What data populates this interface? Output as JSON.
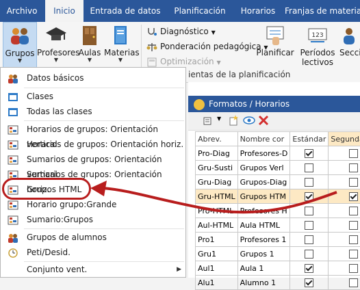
{
  "menubar": {
    "tabs": [
      "Archivo",
      "Inicio",
      "Entrada de datos",
      "Planificación",
      "Horarios",
      "Franjas de materias"
    ]
  },
  "ribbon": {
    "buttons": {
      "grupos": "Grupos",
      "profesores": "Profesores",
      "aulas": "Aulas",
      "materias": "Materias",
      "planificar": "Planificar",
      "periodos": "Períodos lectivos",
      "secciones": "Secci"
    },
    "commands": {
      "diagnostico": "Diagnóstico",
      "ponderacion": "Ponderación pedagógica",
      "optimizacion": "Optimización"
    },
    "group_label": "ientas de la planificación"
  },
  "dropdown": {
    "items": [
      {
        "label": "Datos básicos",
        "icon": "people-icon"
      },
      {
        "label": "Clases",
        "icon": "window-icon"
      },
      {
        "label": "Todas las clases",
        "icon": "window-icon"
      },
      {
        "label": "Horarios de grupos: Orientación vertical",
        "icon": "grid-icon"
      },
      {
        "label": "Horarios de grupos: Orientación horiz.",
        "icon": "grid-icon"
      },
      {
        "label": "Sumarios de grupos: Orientación vertical",
        "icon": "grid-icon"
      },
      {
        "label": "Sumarios de grupos: Orientación horiz.",
        "icon": "grid-icon"
      },
      {
        "label": "Grupos HTML",
        "icon": "grid-icon"
      },
      {
        "label": "Horario grupo:Grande",
        "icon": "grid-icon"
      },
      {
        "label": "Sumario:Grupos",
        "icon": "grid-icon"
      },
      {
        "label": "Grupos de alumnos",
        "icon": "people-icon"
      },
      {
        "label": "Peti/Desid.",
        "icon": "clock-icon"
      },
      {
        "label": "Conjunto vent.",
        "icon": "none"
      }
    ]
  },
  "panel": {
    "title": "Formatos / Horarios",
    "headers": [
      "Abrev.",
      "Nombre cor",
      "Estándar",
      "Segunda op"
    ],
    "rows": [
      {
        "abrev": "Pro-Diag",
        "nombre": "Profesores-D",
        "estandar": true,
        "segunda": false
      },
      {
        "abrev": "Gru-Susti",
        "nombre": "Grupos Verl",
        "estandar": false,
        "segunda": false
      },
      {
        "abrev": "Gru-Diag",
        "nombre": "Grupos-Diag",
        "estandar": false,
        "segunda": false
      },
      {
        "abrev": "Gru-HTML",
        "nombre": "Grupos HTM",
        "estandar": true,
        "segunda": true
      },
      {
        "abrev": "Pro-HTML",
        "nombre": "Profesores H",
        "estandar": false,
        "segunda": false
      },
      {
        "abrev": "Aul-HTML",
        "nombre": "Aula HTML",
        "estandar": false,
        "segunda": false
      },
      {
        "abrev": "Pro1",
        "nombre": "Profesores 1",
        "estandar": false,
        "segunda": false
      },
      {
        "abrev": "Gru1",
        "nombre": "Grupos 1",
        "estandar": false,
        "segunda": false
      },
      {
        "abrev": "Aul1",
        "nombre": "Aula 1",
        "estandar": true,
        "segunda": false
      },
      {
        "abrev": "Alu1",
        "nombre": "Alumno 1",
        "estandar": true,
        "segunda": false
      }
    ]
  },
  "colors": {
    "menubar": "#2b579a",
    "highlight_row": "#fde9c4",
    "annotation": "#b81d1d"
  }
}
